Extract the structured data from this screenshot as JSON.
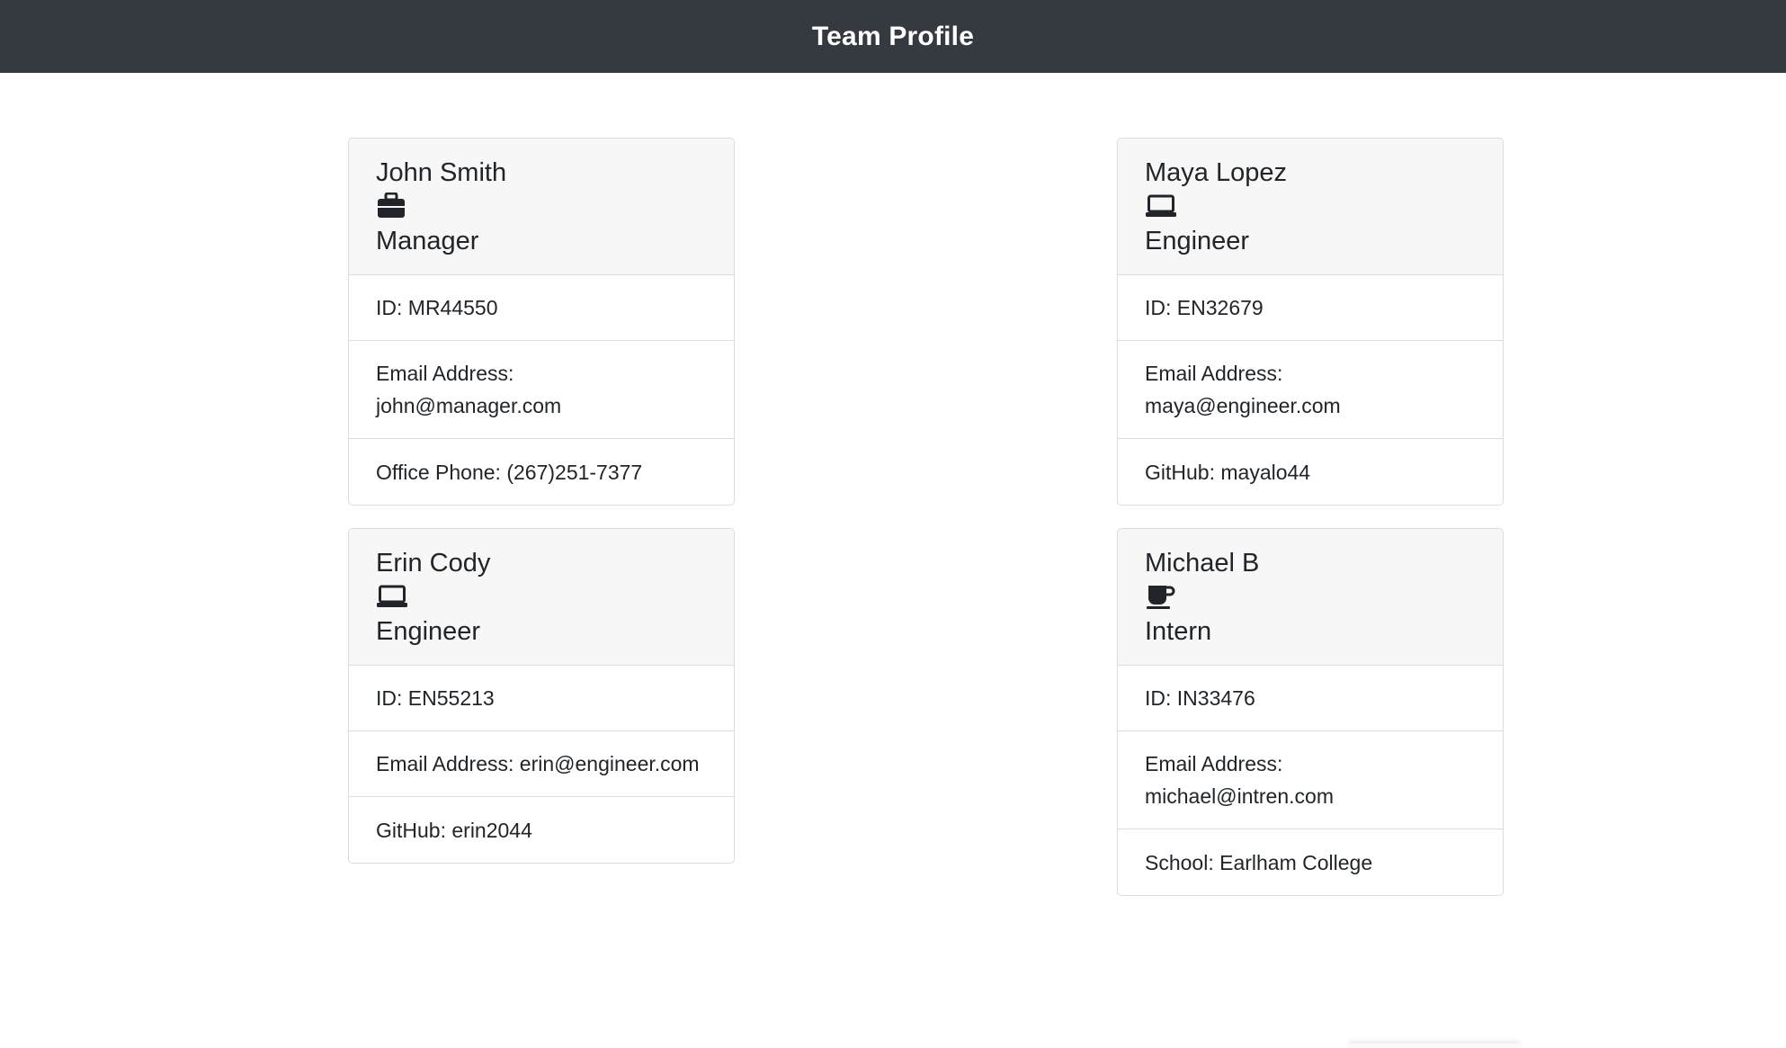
{
  "header": {
    "title": "Team Profile"
  },
  "cards": [
    {
      "name": "John Smith",
      "icon": "briefcase-icon",
      "role": "Manager",
      "id_text": "ID: MR44550",
      "email_label": "Email Address:",
      "email": "john@manager.com",
      "extra": "Office Phone: (267)251-7377"
    },
    {
      "name": "Maya Lopez",
      "icon": "laptop-icon",
      "role": "Engineer",
      "id_text": "ID: EN32679",
      "email_label": "Email Address:",
      "email": "maya@engineer.com",
      "extra": "GitHub: mayalo44"
    },
    {
      "name": "Erin Cody",
      "icon": "laptop-icon",
      "role": "Engineer",
      "id_text": "ID: EN55213",
      "email_label": "Email Address:",
      "email": "erin@engineer.com",
      "extra": "GitHub: erin2044"
    },
    {
      "name": "Michael B",
      "icon": "coffee-mug-icon",
      "role": "Intern",
      "id_text": "ID: IN33476",
      "email_label": "Email Address:",
      "email": "michael@intren.com",
      "extra": "School: Earlham College"
    }
  ],
  "colors": {
    "navbar": "#343a40",
    "card_header": "#f7f7f7",
    "text": "#212529"
  }
}
